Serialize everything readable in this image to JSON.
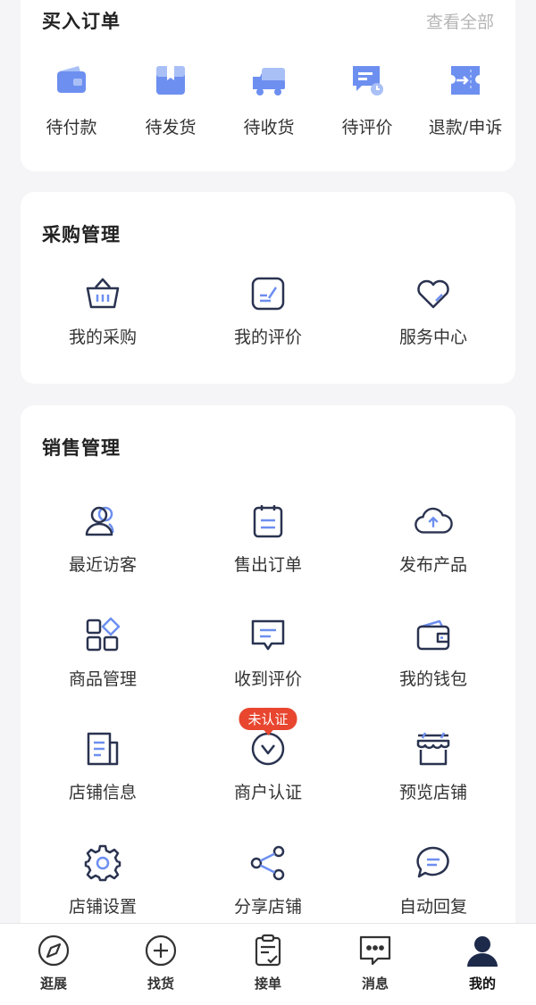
{
  "orders": {
    "title": "买入订单",
    "view_all": "查看全部",
    "items": [
      {
        "label": "待付款",
        "icon": "wallet-icon"
      },
      {
        "label": "待发货",
        "icon": "package-icon"
      },
      {
        "label": "待收货",
        "icon": "truck-icon"
      },
      {
        "label": "待评价",
        "icon": "review-chat-icon"
      },
      {
        "label": "退款/申诉",
        "icon": "refund-ticket-icon"
      }
    ]
  },
  "purchase": {
    "title": "采购管理",
    "items": [
      {
        "label": "我的采购",
        "icon": "basket-icon"
      },
      {
        "label": "我的评价",
        "icon": "edit-review-icon"
      },
      {
        "label": "服务中心",
        "icon": "heart-icon"
      }
    ]
  },
  "sales": {
    "title": "销售管理",
    "items": [
      {
        "label": "最近访客",
        "icon": "visitors-icon"
      },
      {
        "label": "售出订单",
        "icon": "clipboard-icon"
      },
      {
        "label": "发布产品",
        "icon": "cloud-upload-icon"
      },
      {
        "label": "商品管理",
        "icon": "grid-icon"
      },
      {
        "label": "收到评价",
        "icon": "message-icon"
      },
      {
        "label": "我的钱包",
        "icon": "wallet-outline-icon"
      },
      {
        "label": "店铺信息",
        "icon": "document-icon"
      },
      {
        "label": "商户认证",
        "icon": "verify-icon",
        "badge": "未认证"
      },
      {
        "label": "预览店铺",
        "icon": "store-icon"
      },
      {
        "label": "店铺设置",
        "icon": "gear-icon"
      },
      {
        "label": "分享店铺",
        "icon": "share-icon"
      },
      {
        "label": "自动回复",
        "icon": "chat-bubble-icon"
      }
    ]
  },
  "tabbar": {
    "items": [
      {
        "label": "逛展",
        "icon": "compass-icon"
      },
      {
        "label": "找货",
        "icon": "plus-circle-icon"
      },
      {
        "label": "接单",
        "icon": "checklist-icon"
      },
      {
        "label": "消息",
        "icon": "chat-dots-icon"
      },
      {
        "label": "我的",
        "icon": "user-icon",
        "active": true
      }
    ]
  },
  "colors": {
    "accent_blue": "#6d8ff0",
    "accent_light": "#a9c0f7",
    "navy": "#2a3350",
    "badge_red": "#e8462f"
  }
}
